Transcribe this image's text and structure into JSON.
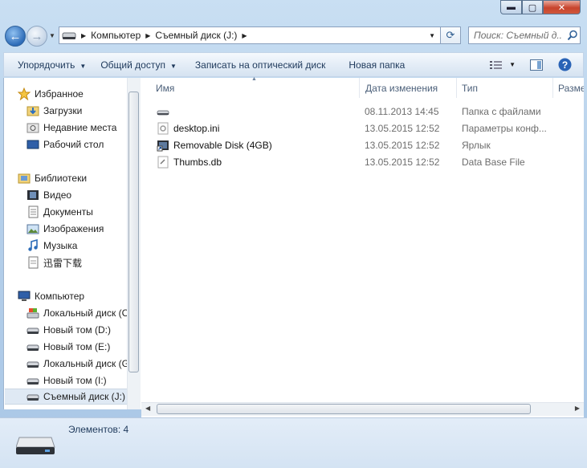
{
  "window": {
    "buttons": {
      "minimize": "▬",
      "maximize": "▢",
      "close": "✕"
    }
  },
  "nav": {
    "back_icon": "arrow-left",
    "forward_icon": "arrow-right",
    "breadcrumb": [
      "Компьютер",
      "Съемный диск (J:)"
    ],
    "search_placeholder": "Поиск: Съемный д..."
  },
  "toolbar": {
    "organize": "Упорядочить",
    "share": "Общий доступ",
    "burn": "Записать на оптический диск",
    "new_folder": "Новая папка"
  },
  "sidebar": {
    "favorites": {
      "label": "Избранное",
      "items": [
        "Загрузки",
        "Недавние места",
        "Рабочий стол"
      ]
    },
    "libraries": {
      "label": "Библиотеки",
      "items": [
        "Видео",
        "Документы",
        "Изображения",
        "Музыка",
        "迅雷下载"
      ]
    },
    "computer": {
      "label": "Компьютер",
      "items": [
        "Локальный диск (C",
        "Новый том (D:)",
        "Новый том (E:)",
        "Локальный диск (G",
        "Новый том (I:)",
        "Съемный диск (J:)"
      ]
    },
    "selected": "Съемный диск (J:)"
  },
  "columns": {
    "name": "Имя",
    "date": "Дата изменения",
    "type": "Тип",
    "size": "Разме"
  },
  "files": [
    {
      "name": "",
      "date": "08.11.2013 14:45",
      "type": "Папка с файлами",
      "icon": "drive-icon"
    },
    {
      "name": "desktop.ini",
      "date": "13.05.2015 12:52",
      "type": "Параметры конф...",
      "icon": "settings-file-icon"
    },
    {
      "name": "Removable Disk (4GB)",
      "date": "13.05.2015 12:52",
      "type": "Ярлык",
      "icon": "shortcut-icon"
    },
    {
      "name": "Thumbs.db",
      "date": "13.05.2015 12:52",
      "type": "Data Base File",
      "icon": "database-file-icon"
    }
  ],
  "details": {
    "count_text": "Элементов: 4"
  }
}
